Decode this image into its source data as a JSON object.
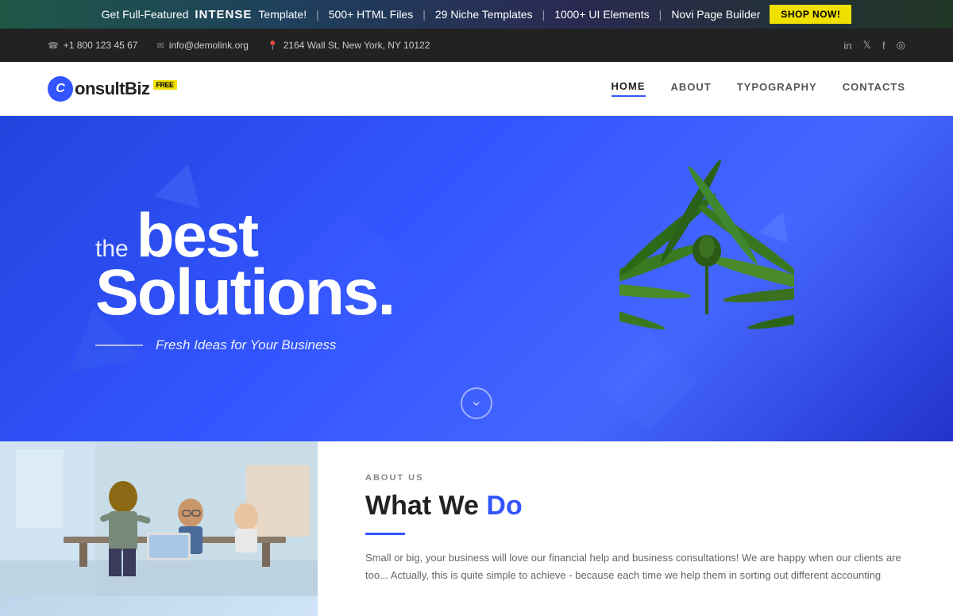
{
  "promo": {
    "prefix": "Get Full-Featured",
    "brand": "INTENSE",
    "suffix": "Template!",
    "features": [
      "500+ HTML Files",
      "29 Niche Templates",
      "1000+ UI Elements",
      "Novi Page Builder"
    ],
    "cta": "SHOP NOW!"
  },
  "contact_bar": {
    "phone": "+1 800 123 45 67",
    "email": "info@demolink.org",
    "address": "2164 Wall St, New York, NY 10122"
  },
  "social": {
    "items": [
      "in",
      "tw",
      "fb",
      "ig"
    ]
  },
  "nav": {
    "logo_letter": "C",
    "logo_text": "onsultBiz",
    "logo_badge": "FREE",
    "items": [
      {
        "label": "HOME",
        "active": true
      },
      {
        "label": "ABOUT",
        "active": false
      },
      {
        "label": "TYPOGRAPHY",
        "active": false
      },
      {
        "label": "CONTACTS",
        "active": false
      }
    ]
  },
  "hero": {
    "subtitle": "the",
    "title_bold": "best",
    "title_main": "Solutions.",
    "tagline": "Fresh Ideas for Your Business",
    "scroll_icon": "›"
  },
  "about": {
    "label": "ABOUT US",
    "title_normal": "What We",
    "title_highlight": "Do",
    "body": "Small or big, your business will love our financial help and business consultations! We are happy when our clients are too... Actually, this is quite simple to achieve - because each time we help them in sorting out different accounting"
  }
}
